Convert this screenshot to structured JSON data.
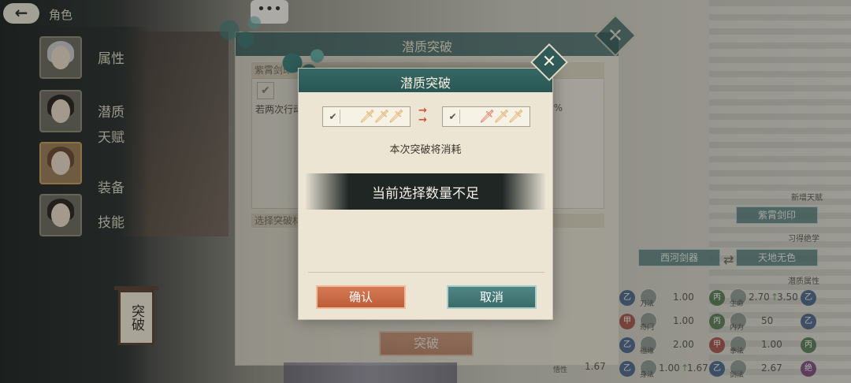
{
  "header": {
    "back_icon": "arrow-left-icon",
    "back_glyph": "←",
    "title": "角色"
  },
  "nav": {
    "items": [
      {
        "label": "属性",
        "active": false
      },
      {
        "label": "潜质",
        "active": false
      },
      {
        "label": "天赋",
        "active": false
      },
      {
        "label": "装备",
        "active": true
      },
      {
        "label": "技能",
        "active": false
      }
    ]
  },
  "side_sign": {
    "label": "突破"
  },
  "chat": {
    "glyph": "•••"
  },
  "back_dialog": {
    "title": "潜质突破",
    "close_glyph": "✕",
    "section_label": "紫霄剑印",
    "check_glyph": "✔",
    "description": "若两次行动",
    "percent": "%",
    "select_label": "选择突破材",
    "break_button": "突破"
  },
  "right_panel": {
    "new_talent_label": "新增天赋",
    "new_talent_value": "紫霄剑印",
    "learned_label": "习得绝学",
    "skill_from": "西河剑器",
    "skill_to": "天地无色",
    "swap_glyph": "⇄",
    "potential_label": "潜质属性",
    "stats": [
      {
        "badge": "乙",
        "name": "刀法",
        "value": "1.00",
        "badge2": "丙",
        "name2": "生命",
        "value2": "2.70",
        "arrow": "↑",
        "value2_new": "3.50",
        "badge3": "乙"
      },
      {
        "badge": "甲",
        "name": "奇门",
        "value": "1.00",
        "badge2": "丙",
        "name2": "内力",
        "value2": "50",
        "arrow": "",
        "value2_new": "",
        "badge3": "乙"
      },
      {
        "badge": "乙",
        "name": "福缘",
        "value": "2.00",
        "badge2": "甲",
        "name2": "拳法",
        "value2": "1.00",
        "arrow": "",
        "value2_new": "",
        "badge3": "丙"
      },
      {
        "badge": "乙",
        "name": "悟性",
        "value": "1.67",
        "badge2": "乙",
        "name2": "身法",
        "value2": "1.00",
        "arrow": "↑",
        "value2_new": "1.67",
        "badge3": "乙",
        "extra_name": "剑法",
        "extra_value": "2.67",
        "extra_badge": "绝"
      }
    ],
    "colors": {
      "badge_yi": "#2f4f7a",
      "badge_jia": "#9b3a2c",
      "badge_bing": "#3f6b3a",
      "badge_jue": "#6c2f6b"
    }
  },
  "dialog": {
    "title": "潜质突破",
    "close_icon": "close-icon",
    "close_glyph": "✕",
    "slot_left": {
      "check": "✔",
      "blades": [
        "🗡",
        "🗡",
        "🗡"
      ]
    },
    "slot_right": {
      "check": "✔",
      "blades": [
        "🗡",
        "🗡",
        "🗡"
      ]
    },
    "convert_arrows": "→\n→",
    "cost_label": "本次突破将消耗",
    "toast": "当前选择数量不足",
    "confirm": "确认",
    "cancel": "取消"
  }
}
